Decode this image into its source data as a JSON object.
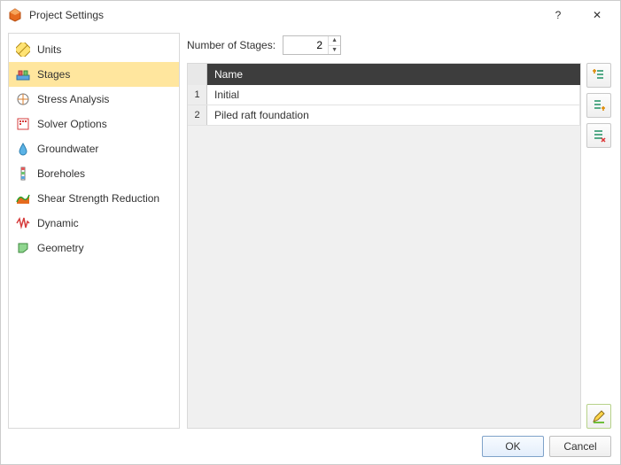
{
  "window": {
    "title": "Project Settings",
    "help": "?",
    "close": "✕"
  },
  "sidebar": {
    "items": [
      {
        "label": "Units",
        "icon": "ruler"
      },
      {
        "label": "Stages",
        "icon": "stages",
        "active": true
      },
      {
        "label": "Stress Analysis",
        "icon": "stress"
      },
      {
        "label": "Solver Options",
        "icon": "solver"
      },
      {
        "label": "Groundwater",
        "icon": "water"
      },
      {
        "label": "Boreholes",
        "icon": "borehole"
      },
      {
        "label": "Shear Strength Reduction",
        "icon": "ssr"
      },
      {
        "label": "Dynamic",
        "icon": "dynamic"
      },
      {
        "label": "Geometry",
        "icon": "geometry"
      }
    ]
  },
  "main": {
    "stage_count_label": "Number of Stages:",
    "stage_count_value": "2",
    "table": {
      "header_name": "Name",
      "rows": [
        {
          "idx": "1",
          "name": "Initial"
        },
        {
          "idx": "2",
          "name": "Piled raft foundation"
        }
      ]
    },
    "side_buttons": {
      "insert_before": "insert-before",
      "insert_after": "insert-after",
      "delete": "delete",
      "edit": "edit"
    }
  },
  "footer": {
    "ok": "OK",
    "cancel": "Cancel"
  }
}
